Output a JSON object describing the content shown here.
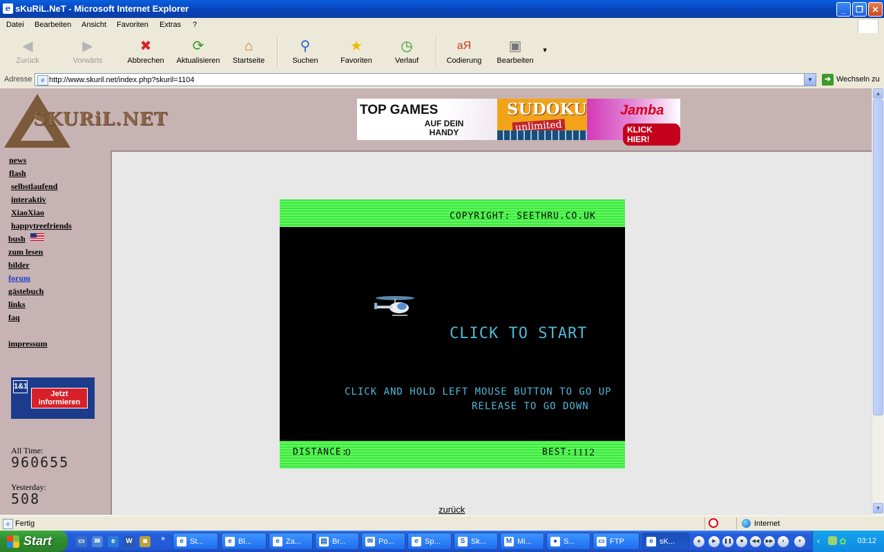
{
  "window": {
    "title": "sKuRiL.NeT - Microsoft Internet Explorer",
    "app_icon": "e"
  },
  "menu": [
    "Datei",
    "Bearbeiten",
    "Ansicht",
    "Favoriten",
    "Extras",
    "?"
  ],
  "toolbar": {
    "back": "Zurück",
    "forward": "Vorwärts",
    "stop": "Abbrechen",
    "refresh": "Aktualisieren",
    "home": "Startseite",
    "search": "Suchen",
    "favorites": "Favoriten",
    "history": "Verlauf",
    "encoding": "Codierung",
    "edit": "Bearbeiten"
  },
  "address": {
    "label": "Adresse",
    "url": "http://www.skuril.net/index.php?skuril=1104",
    "go": "Wechseln zu"
  },
  "site": {
    "logo_text": "SKURiL.NET",
    "banner": {
      "top_games": "TOP GAMES",
      "handy": "AUF DEIN HANDY",
      "sudoku": "SUDOKU",
      "unlimited": "unlimited",
      "jamba": "Jamba",
      "klick": "KLICK HIER!"
    },
    "nav": {
      "news": "news",
      "flash": "flash",
      "selbstlaufend": "selbstlaufend",
      "interaktiv": "interaktiv",
      "xiaoxiao": "XiaoXiao",
      "happytreefriends": "happytreefriends",
      "bush": "bush",
      "zumlesen": "zum lesen",
      "bilder": "bilder",
      "forum": "forum",
      "gastebuch": "gästebuch",
      "links": "links",
      "faq": "faq",
      "impressum": "impressum"
    },
    "ad_1und1": {
      "logo": "1&1",
      "button": "Jetzt informieren"
    },
    "counters": {
      "all_time_label": "All Time:",
      "all_time_value": "960655",
      "yesterday_label": "Yesterday:",
      "yesterday_value": "508"
    },
    "back_link": "zurück"
  },
  "game": {
    "copyright": "COPYRIGHT: SEETHRU.CO.UK",
    "start": "CLICK TO START",
    "instr1": "CLICK AND HOLD LEFT MOUSE BUTTON TO GO UP",
    "instr2": "RELEASE TO GO DOWN",
    "distance_label": "DISTANCE:",
    "distance_value": "0",
    "best_label": "BEST:",
    "best_value": "1112"
  },
  "status": {
    "text": "Fertig",
    "zone": "Internet"
  },
  "taskbar": {
    "start": "Start",
    "tasks": [
      "St...",
      "Bl...",
      "Za...",
      "Br...",
      "Po...",
      "Sp...",
      "Sk...",
      "Mi...",
      "S...",
      "FTP",
      "sK..."
    ],
    "clock": "03:12"
  }
}
